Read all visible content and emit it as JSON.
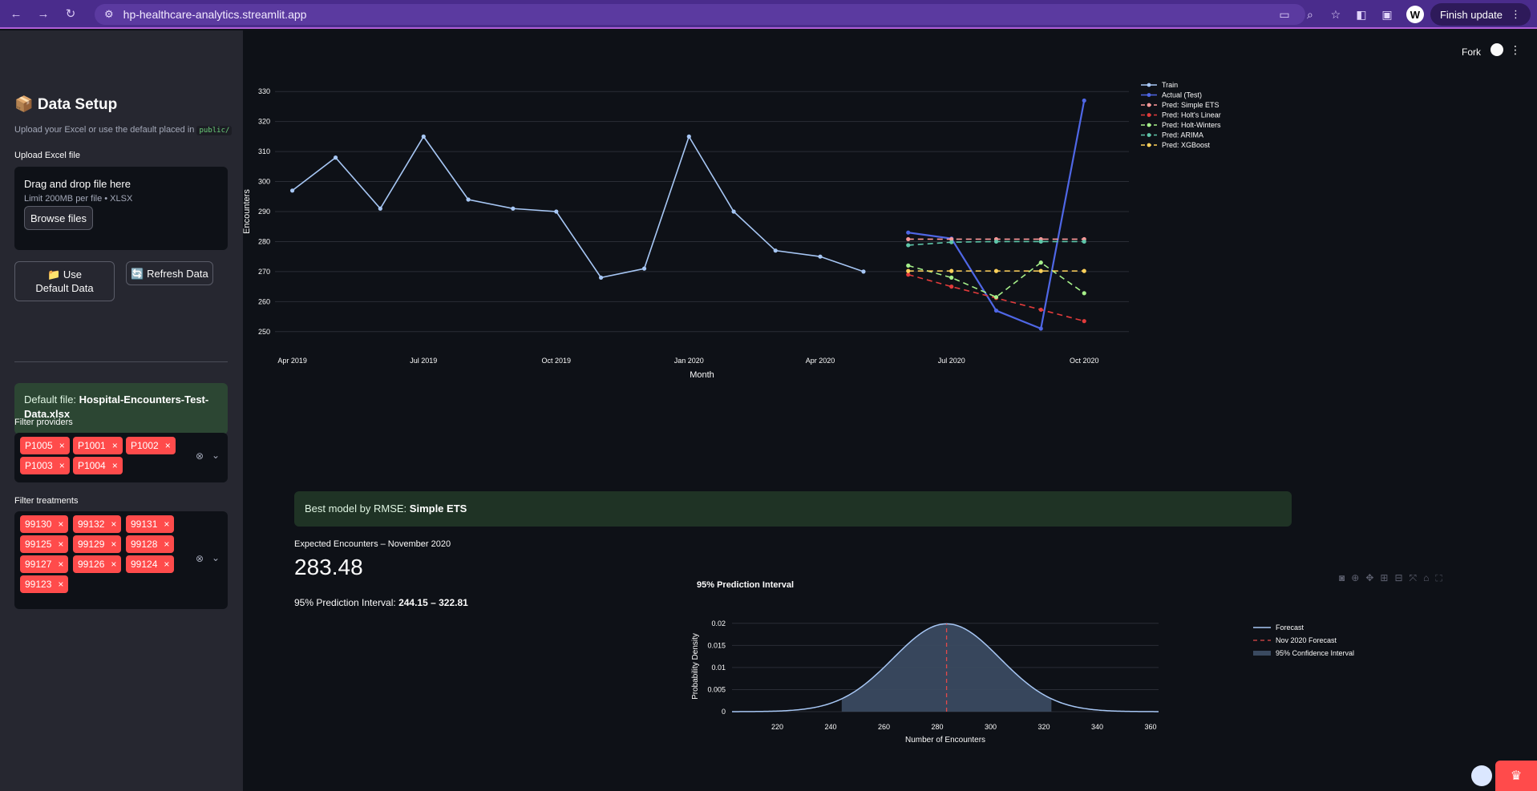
{
  "browser": {
    "url": "hp-healthcare-analytics.streamlit.app",
    "finish_update": "Finish update",
    "avatar_letter": "W"
  },
  "sidebar": {
    "title": "📦 Data Setup",
    "subtitle": "Upload your Excel or use the default placed in",
    "subtitle_code": "public/",
    "upload_label": "Upload Excel file",
    "drag_text": "Drag and drop file here",
    "limit_text": "Limit 200MB per file • XLSX",
    "browse_label": "Browse files",
    "use_default_label": "📁 Use Default Data",
    "refresh_label": "🔄 Refresh Data",
    "default_file_prefix": "Default file:",
    "default_file_name": "Hospital-Encounters-Test-Data.xlsx",
    "providers_label": "Filter providers",
    "providers": [
      "P1005",
      "P1001",
      "P1002",
      "P1003",
      "P1004"
    ],
    "treatments_label": "Filter treatments",
    "treatments": [
      "99130",
      "99132",
      "99131",
      "99125",
      "99129",
      "99128",
      "99127",
      "99126",
      "99124",
      "99123"
    ]
  },
  "header": {
    "fork": "Fork"
  },
  "best_model": {
    "prefix": "Best model by RMSE:",
    "name": "Simple ETS"
  },
  "metric": {
    "label": "Expected Encounters – November 2020",
    "value": "283.48",
    "pi_label": "95% Prediction Interval:",
    "pi_value": "244.15 – 322.81"
  },
  "colors": {
    "train": "#a7c7f5",
    "actual": "#4f67e6",
    "ets": "#ff9a9a",
    "holt": "#e23b3b",
    "hw": "#a6f08a",
    "arima": "#5fc6a9",
    "xgb": "#ffd15a",
    "forecast": "#a7c7f5",
    "ci_fill": "#3a4a60"
  },
  "chart_data": [
    {
      "type": "line",
      "title": "",
      "xlabel": "Month",
      "ylabel": "Encounters",
      "ylim": [
        247,
        333
      ],
      "x_ticks": [
        "Apr 2019",
        "Jul 2019",
        "Oct 2019",
        "Jan 2020",
        "Apr 2020",
        "Jul 2020",
        "Oct 2020"
      ],
      "y_ticks": [
        250,
        260,
        270,
        280,
        290,
        300,
        310,
        320,
        330
      ],
      "legend_position": "top-right",
      "series": [
        {
          "name": "Train",
          "key": "train",
          "dash": false,
          "x": [
            "2019-04",
            "2019-05",
            "2019-06",
            "2019-07",
            "2019-08",
            "2019-09",
            "2019-10",
            "2019-11",
            "2019-12",
            "2020-01",
            "2020-02",
            "2020-03",
            "2020-04",
            "2020-05"
          ],
          "values": [
            297,
            308,
            291,
            315,
            294,
            291,
            290,
            268,
            271,
            315,
            290,
            277,
            275,
            270
          ]
        },
        {
          "name": "Actual (Test)",
          "key": "actual",
          "dash": false,
          "x": [
            "2020-06",
            "2020-07",
            "2020-08",
            "2020-09",
            "2020-10"
          ],
          "values": [
            283,
            281,
            257,
            251,
            327
          ]
        },
        {
          "name": "Pred: Simple ETS",
          "key": "ets",
          "dash": true,
          "x": [
            "2020-06",
            "2020-07",
            "2020-08",
            "2020-09",
            "2020-10"
          ],
          "values": [
            280.8,
            280.8,
            280.8,
            280.8,
            280.8
          ]
        },
        {
          "name": "Pred: Holt's Linear",
          "key": "holt",
          "dash": true,
          "x": [
            "2020-06",
            "2020-07",
            "2020-08",
            "2020-09",
            "2020-10"
          ],
          "values": [
            269,
            265,
            261.2,
            257.3,
            253.5
          ]
        },
        {
          "name": "Pred: Holt-Winters",
          "key": "hw",
          "dash": true,
          "x": [
            "2020-06",
            "2020-07",
            "2020-08",
            "2020-09",
            "2020-10"
          ],
          "values": [
            272,
            268,
            261.5,
            273,
            262.8
          ]
        },
        {
          "name": "Pred: ARIMA",
          "key": "arima",
          "dash": true,
          "x": [
            "2020-06",
            "2020-07",
            "2020-08",
            "2020-09",
            "2020-10"
          ],
          "values": [
            278.8,
            279.8,
            280,
            280,
            280
          ]
        },
        {
          "name": "Pred: XGBoost",
          "key": "xgb",
          "dash": true,
          "x": [
            "2020-06",
            "2020-07",
            "2020-08",
            "2020-09",
            "2020-10"
          ],
          "values": [
            270.2,
            270.2,
            270.2,
            270.2,
            270.2
          ]
        }
      ]
    },
    {
      "type": "area",
      "title": "95% Prediction Interval",
      "xlabel": "Number of Encounters",
      "ylabel": "Probability Density",
      "xlim": [
        203,
        363
      ],
      "ylim": [
        0,
        0.0205
      ],
      "x_ticks": [
        220,
        240,
        260,
        280,
        300,
        320,
        340,
        360
      ],
      "y_ticks": [
        0,
        0.005,
        0.01,
        0.015,
        0.02
      ],
      "y_tick_labels": [
        "0",
        "0.005",
        "0.01",
        "0.015",
        "0.02"
      ],
      "mean": 283.48,
      "sd": 20.07,
      "ci": [
        244.15,
        322.81
      ],
      "legend_position": "top-right",
      "legend": [
        "Forecast",
        "Nov 2020 Forecast",
        "95% Confidence Interval"
      ]
    }
  ]
}
